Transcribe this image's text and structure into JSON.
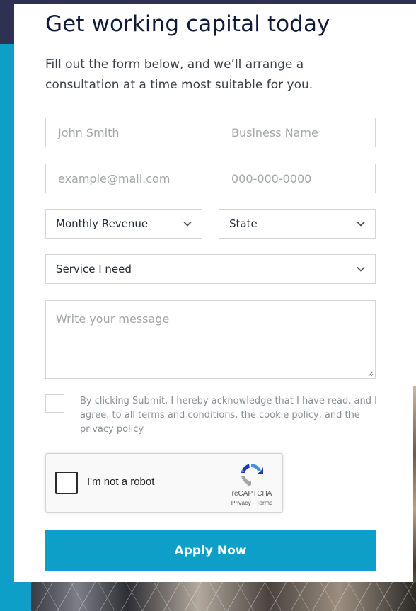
{
  "form": {
    "title": "Get working capital today",
    "subtitle": "Fill out the form below, and we’ll arrange a consultation at a time most suitable for you.",
    "fields": {
      "name_placeholder": "John Smith",
      "business_placeholder": "Business Name",
      "email_placeholder": "example@mail.com",
      "phone_placeholder": "000-000-0000",
      "revenue_select": "Monthly Revenue",
      "state_select": "State",
      "service_select": "Service I need",
      "message_placeholder": "Write your message"
    },
    "consent": {
      "checked": false,
      "text": "By clicking Submit, I hereby acknowledge that I have read, and I agree, to all terms and conditions, the cookie policy, and the privacy policy"
    },
    "recaptcha": {
      "label": "I'm not a robot",
      "brand": "reCAPTCHA",
      "links": "Privacy - Terms"
    },
    "submit_label": "Apply Now"
  },
  "colors": {
    "accent": "#0d9fc7",
    "title": "#0f1a3a",
    "dark_band": "#2e3152"
  }
}
